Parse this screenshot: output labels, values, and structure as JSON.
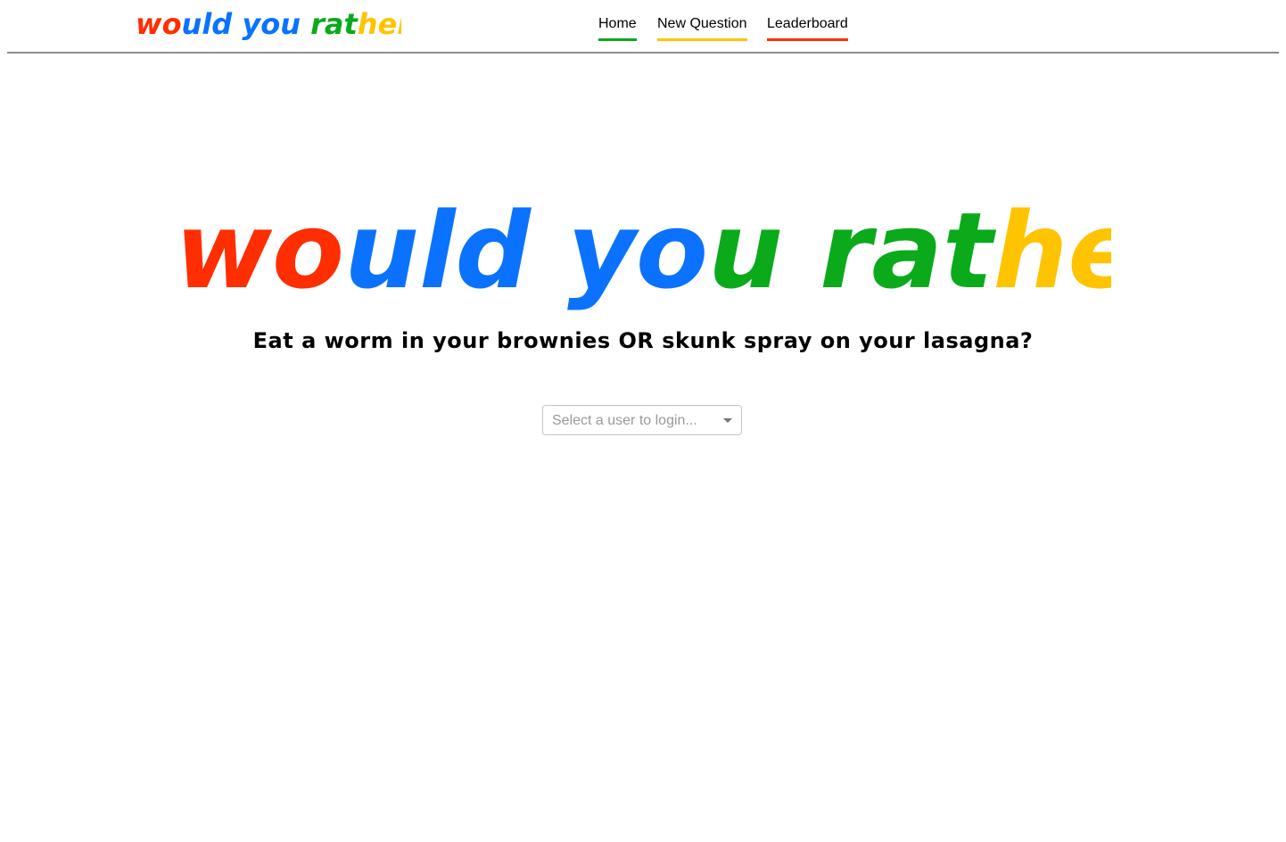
{
  "brand": {
    "logo_text": "would you rather?",
    "colors": {
      "red": "#ff2e00",
      "blue": "#0a72ff",
      "green": "#0aaa1b",
      "yellow": "#ffc400"
    }
  },
  "nav": {
    "items": [
      {
        "label": "Home",
        "underline_color": "#0aaa1b"
      },
      {
        "label": "New Question",
        "underline_color": "#ffc400"
      },
      {
        "label": "Leaderboard",
        "underline_color": "#ff2e00"
      }
    ]
  },
  "hero": {
    "logo_text": "would you rather?",
    "tagline": "Eat a worm in your brownies OR skunk spray on your lasagna?"
  },
  "login": {
    "placeholder": "Select a user to login..."
  }
}
